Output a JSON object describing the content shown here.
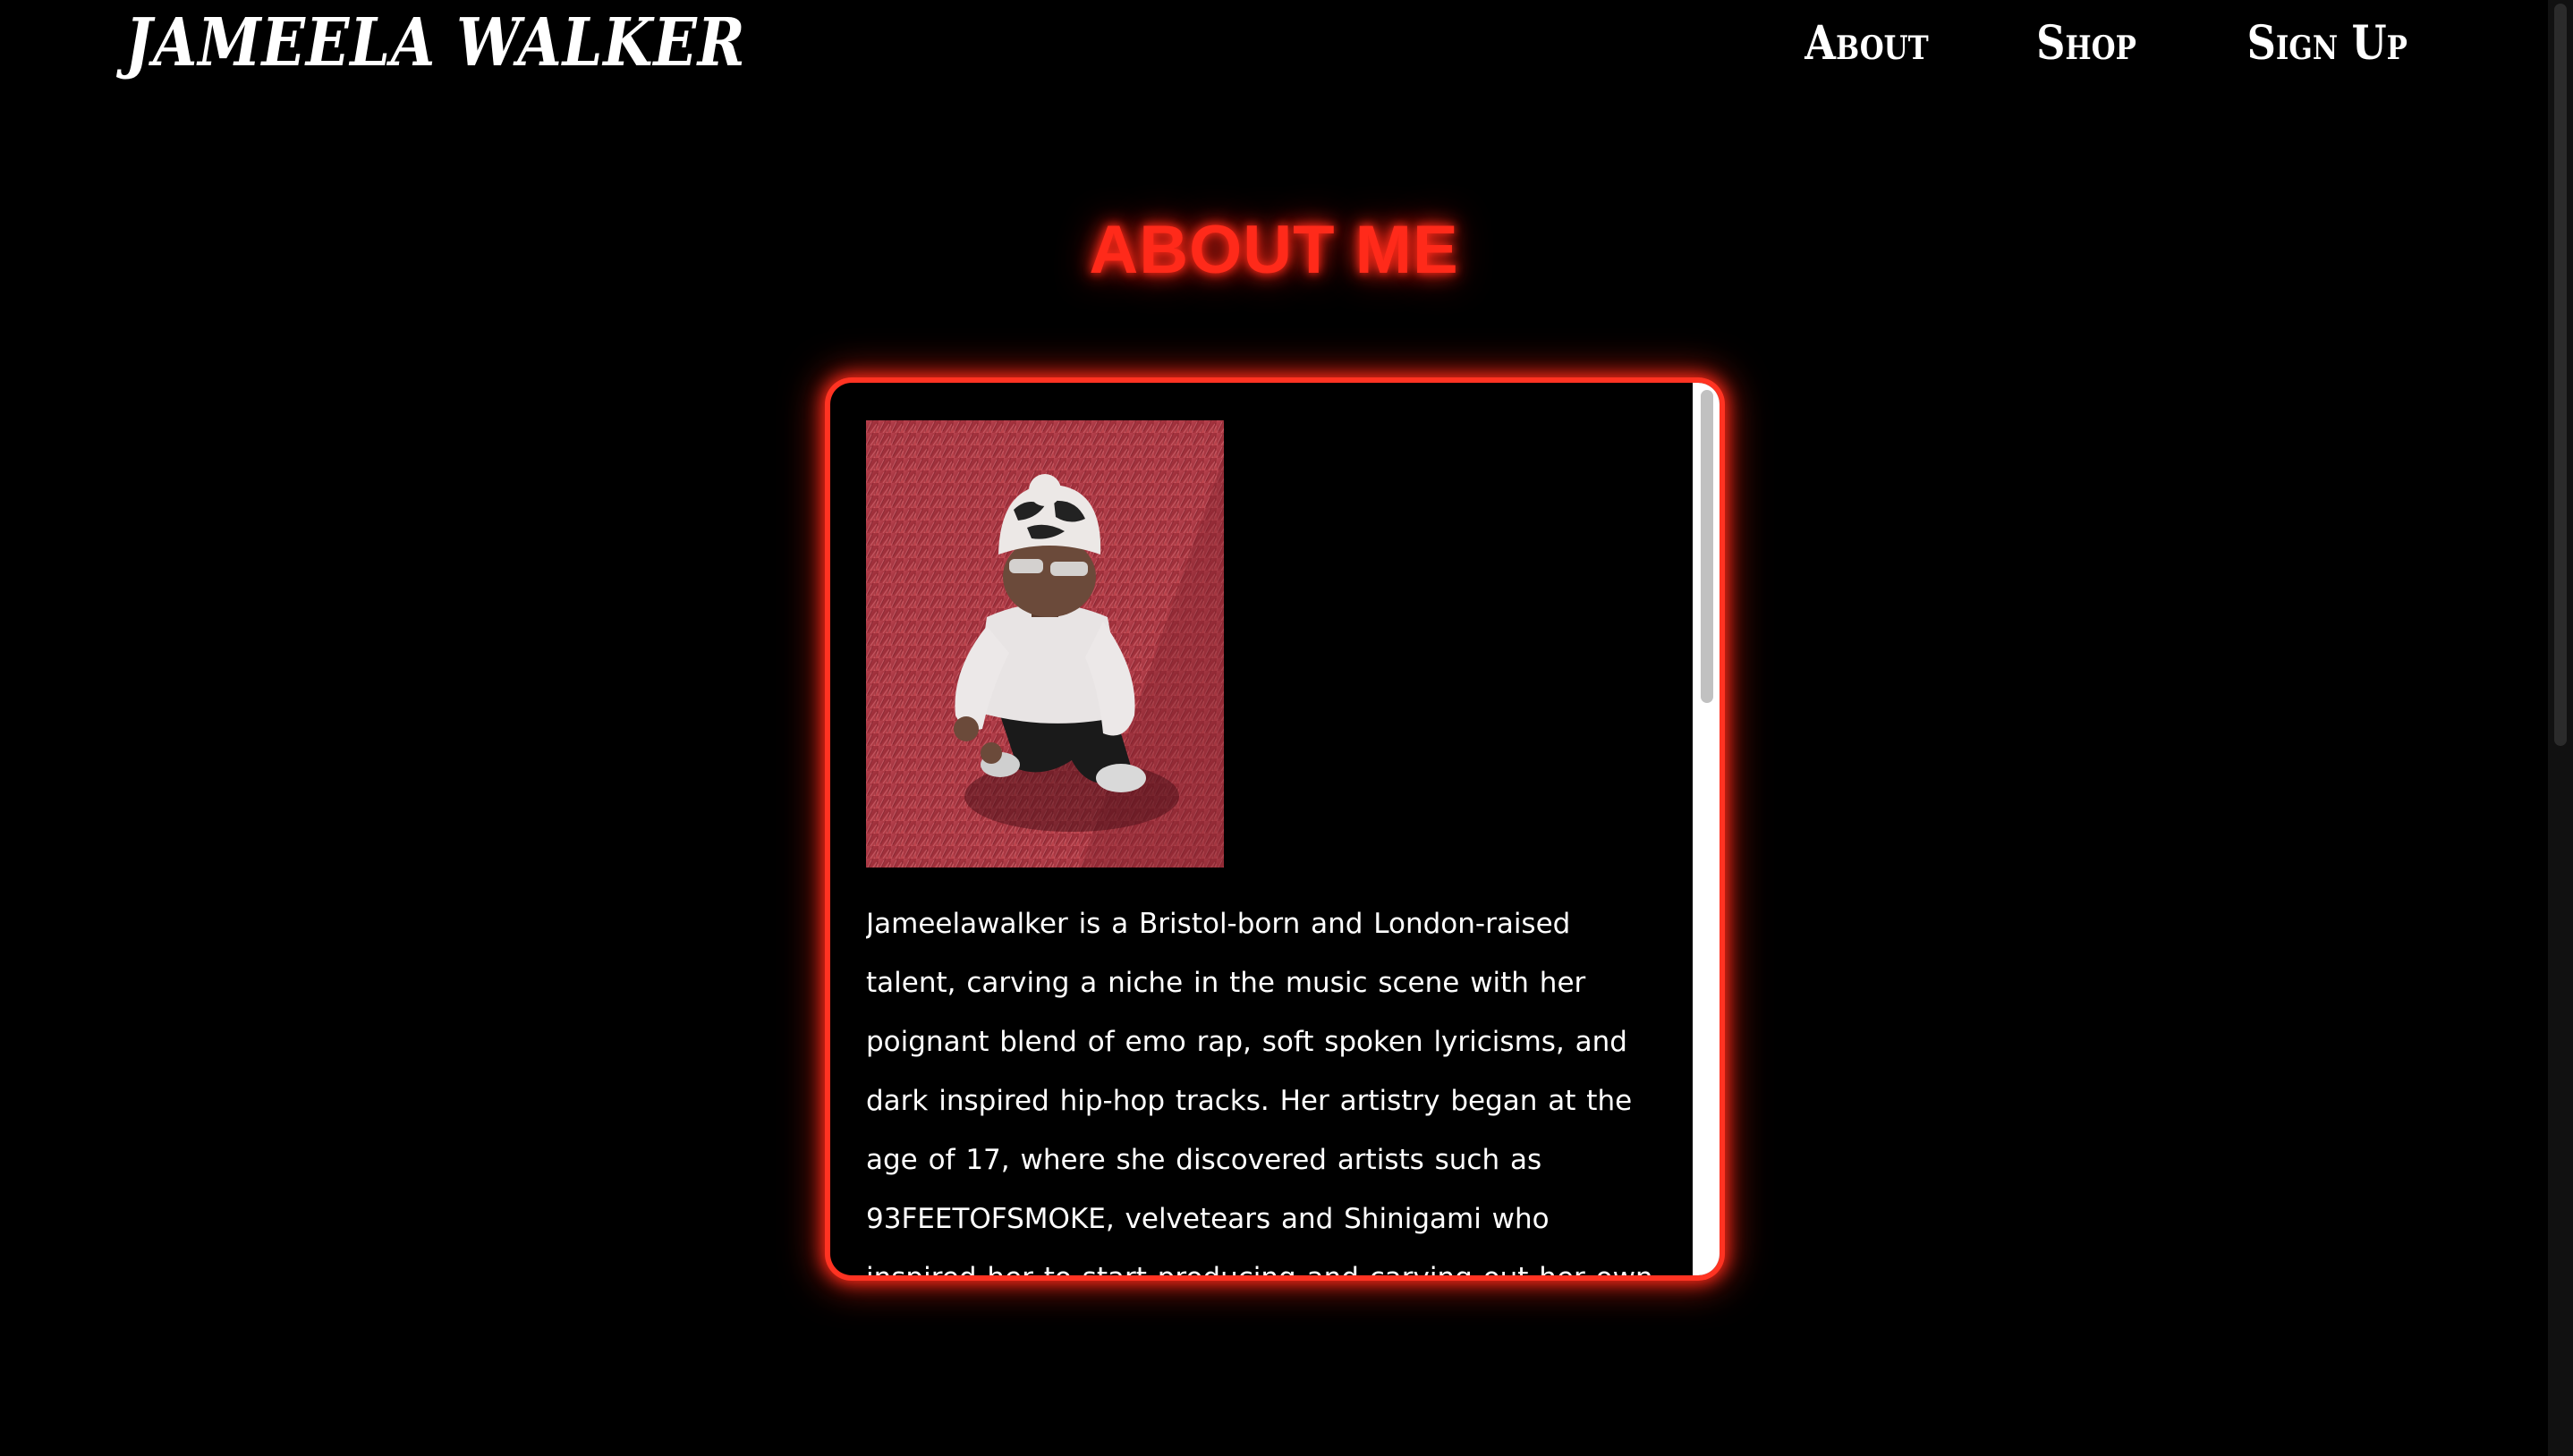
{
  "header": {
    "brand": "JAMEELA WALKER",
    "nav": [
      {
        "label": "About"
      },
      {
        "label": "Shop"
      },
      {
        "label": "Sign Up"
      }
    ]
  },
  "main": {
    "title": "ABOUT ME",
    "bio": "Jameelawalker is a Bristol-born and London-raised talent, carving a niche in the music scene with her poignant blend of emo rap, soft spoken lyricisms, and dark inspired hip-hop tracks. Her artistry began at the age of 17, where she discovered artists such as 93FEETOFSMOKE, velvetears and Shinigami who inspired her to start producing and carving out her own distinctive sound, transforming her bedroom into a creative haven. \"At the time I"
  },
  "colors": {
    "accent": "#ff2a1a",
    "background": "#000000",
    "text": "#ffffff"
  },
  "icons": {
    "photo": "artist-photo"
  }
}
